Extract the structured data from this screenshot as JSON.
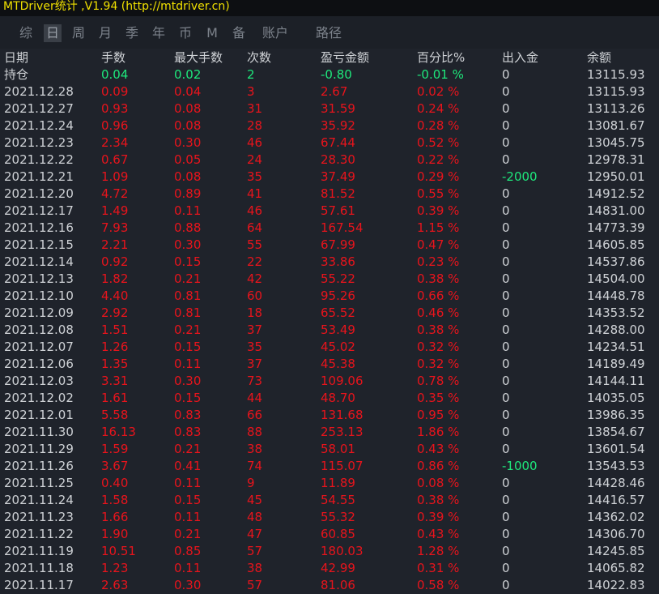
{
  "window": {
    "title": "MTDriver统计 ,V1.94 (http://mtdriver.cn)"
  },
  "tabs": [
    {
      "label": "综",
      "active": false
    },
    {
      "label": "日",
      "active": true
    },
    {
      "label": "周",
      "active": false
    },
    {
      "label": "月",
      "active": false
    },
    {
      "label": "季",
      "active": false
    },
    {
      "label": "年",
      "active": false
    },
    {
      "label": "币",
      "active": false
    },
    {
      "label": "M",
      "active": false
    },
    {
      "label": "备",
      "active": false
    },
    {
      "label": "账户",
      "active": false
    },
    {
      "label": "路径",
      "active": false
    }
  ],
  "table": {
    "headers": [
      "日期",
      "手数",
      "最大手数",
      "次数",
      "盈亏金额",
      "百分比%",
      "出入金",
      "余额"
    ],
    "rows": [
      [
        "持仓",
        "0.04",
        "0.02",
        "2",
        "-0.80",
        "-0.01 %",
        "0",
        "13115.93"
      ],
      [
        "2021.12.28",
        "0.09",
        "0.04",
        "3",
        "2.67",
        "0.02 %",
        "0",
        "13115.93"
      ],
      [
        "2021.12.27",
        "0.93",
        "0.08",
        "31",
        "31.59",
        "0.24 %",
        "0",
        "13113.26"
      ],
      [
        "2021.12.24",
        "0.96",
        "0.08",
        "28",
        "35.92",
        "0.28 %",
        "0",
        "13081.67"
      ],
      [
        "2021.12.23",
        "2.34",
        "0.30",
        "46",
        "67.44",
        "0.52 %",
        "0",
        "13045.75"
      ],
      [
        "2021.12.22",
        "0.67",
        "0.05",
        "24",
        "28.30",
        "0.22 %",
        "0",
        "12978.31"
      ],
      [
        "2021.12.21",
        "1.09",
        "0.08",
        "35",
        "37.49",
        "0.29 %",
        "-2000",
        "12950.01"
      ],
      [
        "2021.12.20",
        "4.72",
        "0.89",
        "41",
        "81.52",
        "0.55 %",
        "0",
        "14912.52"
      ],
      [
        "2021.12.17",
        "1.49",
        "0.11",
        "46",
        "57.61",
        "0.39 %",
        "0",
        "14831.00"
      ],
      [
        "2021.12.16",
        "7.93",
        "0.88",
        "64",
        "167.54",
        "1.15 %",
        "0",
        "14773.39"
      ],
      [
        "2021.12.15",
        "2.21",
        "0.30",
        "55",
        "67.99",
        "0.47 %",
        "0",
        "14605.85"
      ],
      [
        "2021.12.14",
        "0.92",
        "0.15",
        "22",
        "33.86",
        "0.23 %",
        "0",
        "14537.86"
      ],
      [
        "2021.12.13",
        "1.82",
        "0.21",
        "42",
        "55.22",
        "0.38 %",
        "0",
        "14504.00"
      ],
      [
        "2021.12.10",
        "4.40",
        "0.81",
        "60",
        "95.26",
        "0.66 %",
        "0",
        "14448.78"
      ],
      [
        "2021.12.09",
        "2.92",
        "0.81",
        "18",
        "65.52",
        "0.46 %",
        "0",
        "14353.52"
      ],
      [
        "2021.12.08",
        "1.51",
        "0.21",
        "37",
        "53.49",
        "0.38 %",
        "0",
        "14288.00"
      ],
      [
        "2021.12.07",
        "1.26",
        "0.15",
        "35",
        "45.02",
        "0.32 %",
        "0",
        "14234.51"
      ],
      [
        "2021.12.06",
        "1.35",
        "0.11",
        "37",
        "45.38",
        "0.32 %",
        "0",
        "14189.49"
      ],
      [
        "2021.12.03",
        "3.31",
        "0.30",
        "73",
        "109.06",
        "0.78 %",
        "0",
        "14144.11"
      ],
      [
        "2021.12.02",
        "1.61",
        "0.15",
        "44",
        "48.70",
        "0.35 %",
        "0",
        "14035.05"
      ],
      [
        "2021.12.01",
        "5.58",
        "0.83",
        "66",
        "131.68",
        "0.95 %",
        "0",
        "13986.35"
      ],
      [
        "2021.11.30",
        "16.13",
        "0.83",
        "88",
        "253.13",
        "1.86 %",
        "0",
        "13854.67"
      ],
      [
        "2021.11.29",
        "1.59",
        "0.21",
        "38",
        "58.01",
        "0.43 %",
        "0",
        "13601.54"
      ],
      [
        "2021.11.26",
        "3.67",
        "0.41",
        "74",
        "115.07",
        "0.86 %",
        "-1000",
        "13543.53"
      ],
      [
        "2021.11.25",
        "0.40",
        "0.11",
        "9",
        "11.89",
        "0.08 %",
        "0",
        "14428.46"
      ],
      [
        "2021.11.24",
        "1.58",
        "0.15",
        "45",
        "54.55",
        "0.38 %",
        "0",
        "14416.57"
      ],
      [
        "2021.11.23",
        "1.66",
        "0.11",
        "48",
        "55.32",
        "0.39 %",
        "0",
        "14362.02"
      ],
      [
        "2021.11.22",
        "1.90",
        "0.21",
        "47",
        "60.85",
        "0.43 %",
        "0",
        "14306.70"
      ],
      [
        "2021.11.19",
        "10.51",
        "0.85",
        "57",
        "180.03",
        "1.28 %",
        "0",
        "14245.85"
      ],
      [
        "2021.11.18",
        "1.23",
        "0.11",
        "38",
        "42.99",
        "0.31 %",
        "0",
        "14065.82"
      ],
      [
        "2021.11.17",
        "2.63",
        "0.30",
        "57",
        "81.06",
        "0.58 %",
        "0",
        "14022.83"
      ]
    ]
  },
  "colors": {
    "background": "#1f232b",
    "title": "#f0e000",
    "negative_profit": "#e8141c",
    "positive_green": "#1ee87c",
    "neutral": "#cfd2d6"
  }
}
